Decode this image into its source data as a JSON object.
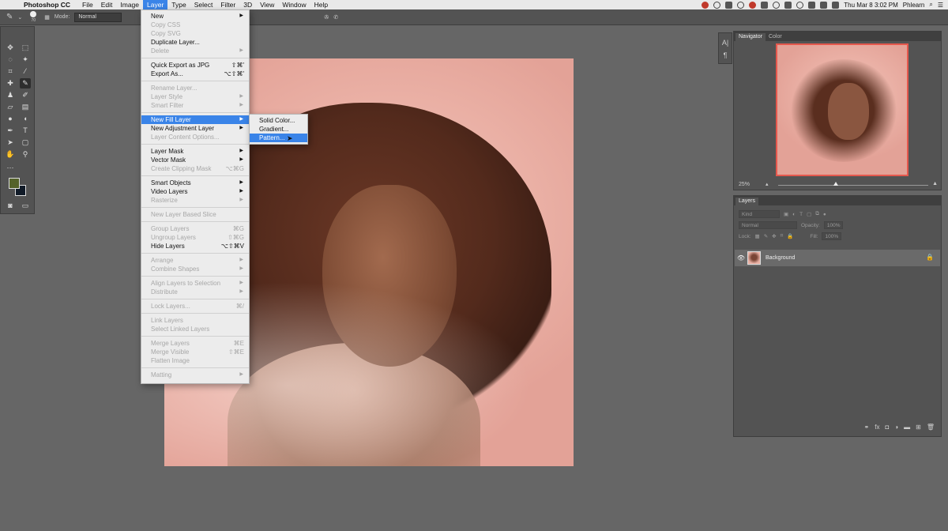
{
  "menubar": {
    "app": "Photoshop CC",
    "menus": [
      "File",
      "Edit",
      "Image",
      "Layer",
      "Type",
      "Select",
      "Filter",
      "3D",
      "View",
      "Window",
      "Help"
    ],
    "active_menu": "Layer",
    "datetime": "Thu Mar 8  3:02 PM",
    "user": "Phlearn"
  },
  "optbar": {
    "brush_size": "70",
    "mode_label": "Mode:",
    "mode_value": "Normal"
  },
  "layer_menu": {
    "new": "New",
    "copy_css": "Copy CSS",
    "copy_svg": "Copy SVG",
    "duplicate": "Duplicate Layer...",
    "delete": "Delete",
    "quick_export": "Quick Export as JPG",
    "quick_export_sc": "⇧⌘'",
    "export_as": "Export As...",
    "export_as_sc": "⌥⇧⌘'",
    "rename": "Rename Layer...",
    "layer_style": "Layer Style",
    "smart_filter": "Smart Filter",
    "new_fill": "New Fill Layer",
    "new_adjustment": "New Adjustment Layer",
    "content_options": "Layer Content Options...",
    "layer_mask": "Layer Mask",
    "vector_mask": "Vector Mask",
    "clipping_mask": "Create Clipping Mask",
    "clipping_mask_sc": "⌥⌘G",
    "smart_objects": "Smart Objects",
    "video_layers": "Video Layers",
    "rasterize": "Rasterize",
    "new_slice": "New Layer Based Slice",
    "group": "Group Layers",
    "group_sc": "⌘G",
    "ungroup": "Ungroup Layers",
    "ungroup_sc": "⇧⌘G",
    "hide": "Hide Layers",
    "hide_sc": "⌥⇧⌘V",
    "arrange": "Arrange",
    "combine": "Combine Shapes",
    "align": "Align Layers to Selection",
    "distribute": "Distribute",
    "lock": "Lock Layers...",
    "lock_sc": "⌘/",
    "link": "Link Layers",
    "select_linked": "Select Linked Layers",
    "merge": "Merge Layers",
    "merge_sc": "⌘E",
    "merge_visible": "Merge Visible",
    "merge_visible_sc": "⇧⌘E",
    "flatten": "Flatten Image",
    "matting": "Matting"
  },
  "fill_submenu": {
    "solid": "Solid Color...",
    "gradient": "Gradient...",
    "pattern": "Pattern..."
  },
  "side_strip": {
    "a": "A|",
    "b": "¶"
  },
  "navigator": {
    "tab_nav": "Navigator",
    "tab_color": "Color",
    "zoom": "25%"
  },
  "layers": {
    "tab": "Layers",
    "kind": "Kind",
    "blend": "Normal",
    "opacity_label": "Opacity:",
    "opacity": "100%",
    "lock_label": "Lock:",
    "fill_label": "Fill:",
    "fill": "100%",
    "bg_name": "Background"
  },
  "colors": {
    "accent": "#3a84e8",
    "foreground": "#55622a",
    "background": "#111b28",
    "nav_frame": "#e5584d"
  }
}
